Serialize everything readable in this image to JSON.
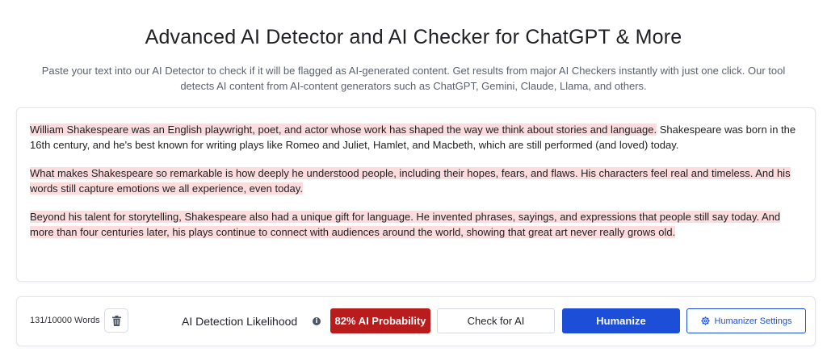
{
  "header": {
    "title": "Advanced AI Detector and AI Checker for ChatGPT & More",
    "subtitle": "Paste your text into our AI Detector to check if it will be flagged as AI-generated content. Get results from major AI Checkers instantly with just one click. Our tool detects AI content from AI-content generators such as ChatGPT, Gemini, Claude, Llama, and others."
  },
  "editor": {
    "paragraphs": [
      {
        "highlighted": "William Shakespeare was an English playwright, poet, and actor whose work has shaped the way we think about stories and language.",
        "plain": " Shakespeare was born in the 16th century, and he's best known for writing plays like Romeo and Juliet, Hamlet, and Macbeth, which are still performed (and loved) today."
      },
      {
        "highlighted": " What makes Shakespeare so remarkable is how deeply he understood people, including their hopes, fears, and flaws. His characters feel real and timeless. And his words still capture emotions we all experience, even today.",
        "plain": ""
      },
      {
        "highlighted": " Beyond his talent for storytelling, Shakespeare also had a unique gift for language. He invented phrases, sayings, and expressions that people still say today. And more than four centuries later, his plays continue to connect with audiences around the world, showing that great art never really grows old.",
        "plain": ""
      }
    ],
    "highlight_color": "#fcdcdc"
  },
  "toolbar": {
    "word_count": "131/10000 Words",
    "clear_icon": "trash-icon",
    "likelihood_label": "AI Detection Likelihood",
    "info_icon": "info-icon",
    "probability_badge": "82% AI Probability",
    "check_button": "Check for AI",
    "humanize_button": "Humanize",
    "settings_button": "Humanizer Settings",
    "settings_icon": "gear-icon"
  },
  "colors": {
    "danger": "#b91c1c",
    "primary": "#1d4ed8"
  }
}
